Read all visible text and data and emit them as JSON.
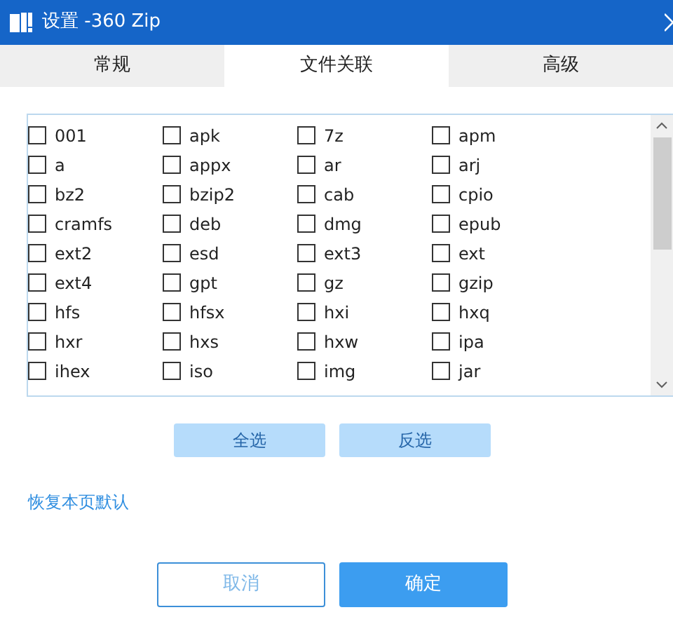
{
  "window": {
    "title": "设置 -360 Zip"
  },
  "tabs": [
    {
      "label": "常规",
      "selected": false
    },
    {
      "label": "文件关联",
      "selected": true
    },
    {
      "label": "高级",
      "selected": false
    }
  ],
  "file_types": [
    {
      "label": "001",
      "checked": false
    },
    {
      "label": "apk",
      "checked": false
    },
    {
      "label": "7z",
      "checked": false
    },
    {
      "label": "apm",
      "checked": false
    },
    {
      "label": "a",
      "checked": false
    },
    {
      "label": "appx",
      "checked": false
    },
    {
      "label": "ar",
      "checked": false
    },
    {
      "label": "arj",
      "checked": false
    },
    {
      "label": "bz2",
      "checked": false
    },
    {
      "label": "bzip2",
      "checked": false
    },
    {
      "label": "cab",
      "checked": false
    },
    {
      "label": "cpio",
      "checked": false
    },
    {
      "label": "cramfs",
      "checked": false
    },
    {
      "label": "deb",
      "checked": false
    },
    {
      "label": "dmg",
      "checked": false
    },
    {
      "label": "epub",
      "checked": false
    },
    {
      "label": "ext2",
      "checked": false
    },
    {
      "label": "esd",
      "checked": false
    },
    {
      "label": "ext3",
      "checked": false
    },
    {
      "label": "ext",
      "checked": false
    },
    {
      "label": "ext4",
      "checked": false
    },
    {
      "label": "gpt",
      "checked": false
    },
    {
      "label": "gz",
      "checked": false
    },
    {
      "label": "gzip",
      "checked": false
    },
    {
      "label": "hfs",
      "checked": false
    },
    {
      "label": "hfsx",
      "checked": false
    },
    {
      "label": "hxi",
      "checked": false
    },
    {
      "label": "hxq",
      "checked": false
    },
    {
      "label": "hxr",
      "checked": false
    },
    {
      "label": "hxs",
      "checked": false
    },
    {
      "label": "hxw",
      "checked": false
    },
    {
      "label": "ipa",
      "checked": false
    },
    {
      "label": "ihex",
      "checked": false
    },
    {
      "label": "iso",
      "checked": false
    },
    {
      "label": "img",
      "checked": false
    },
    {
      "label": "jar",
      "checked": false
    }
  ],
  "selection_buttons": [
    "全选",
    "反选"
  ],
  "restore_link": "恢复本页默认",
  "buttons": [
    {
      "label": "取消",
      "kind": "secondary"
    },
    {
      "label": "确定",
      "kind": "primary"
    }
  ]
}
